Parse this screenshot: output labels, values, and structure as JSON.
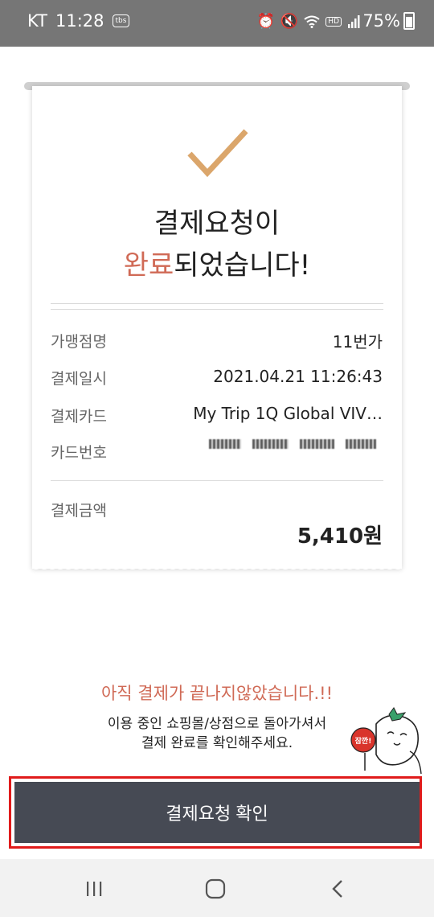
{
  "status_bar": {
    "carrier": "KT",
    "time": "11:28",
    "app_badge": "tbs",
    "battery": "75%",
    "hd_label": "HD"
  },
  "receipt": {
    "title_line1": "결제요청이",
    "title_line2_accent": "완료",
    "title_line2_rest": "되었습니다!",
    "rows": [
      {
        "label": "가맹점명",
        "value": "11번가"
      },
      {
        "label": "결제일시",
        "value": "2021.04.21 11:26:43"
      },
      {
        "label": "결제카드",
        "value": "My Trip 1Q Global VIV…"
      },
      {
        "label": "카드번호",
        "value": ""
      }
    ],
    "amount_label": "결제금액",
    "amount_value": "5,410원"
  },
  "notice": {
    "headline": "아직 결제가 끝나지않았습니다.!!",
    "line1": "이용 중인 쇼핑몰/상점으로 돌아가셔서",
    "line2": "결제 완료를 확인해주세요.",
    "mascot_sign": "잠깐!"
  },
  "confirm_button": {
    "label": "결제요청 확인"
  },
  "colors": {
    "accent": "#d06a56",
    "check": "#dba66b",
    "button": "#464a54",
    "outline": "#e01b1b"
  }
}
